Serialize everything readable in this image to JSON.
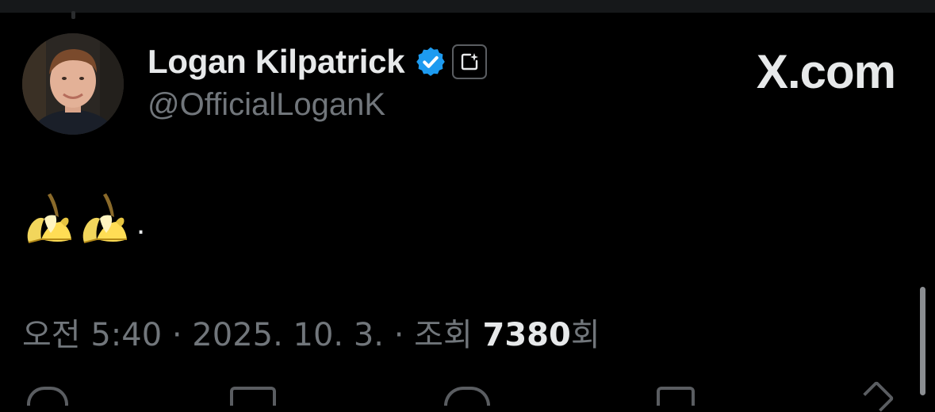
{
  "author": {
    "display_name": "Logan Kilpatrick",
    "handle": "@OfficialLoganK",
    "verified": true,
    "avatar_icon": "profile-photo"
  },
  "brand": {
    "x_mark": "X",
    "suffix": ".com"
  },
  "tweet": {
    "emojis": [
      "banana",
      "banana"
    ],
    "trailing_text": "."
  },
  "meta": {
    "time": "오전 5:40",
    "separator": " · ",
    "date": "2025. 10. 3.",
    "views_prefix": "조회 ",
    "views_count": "7380",
    "views_suffix": "회"
  },
  "colors": {
    "background": "#000000",
    "primary_text": "#e7e9ea",
    "secondary_text": "#71767b",
    "verified_blue": "#1d9bf0"
  }
}
